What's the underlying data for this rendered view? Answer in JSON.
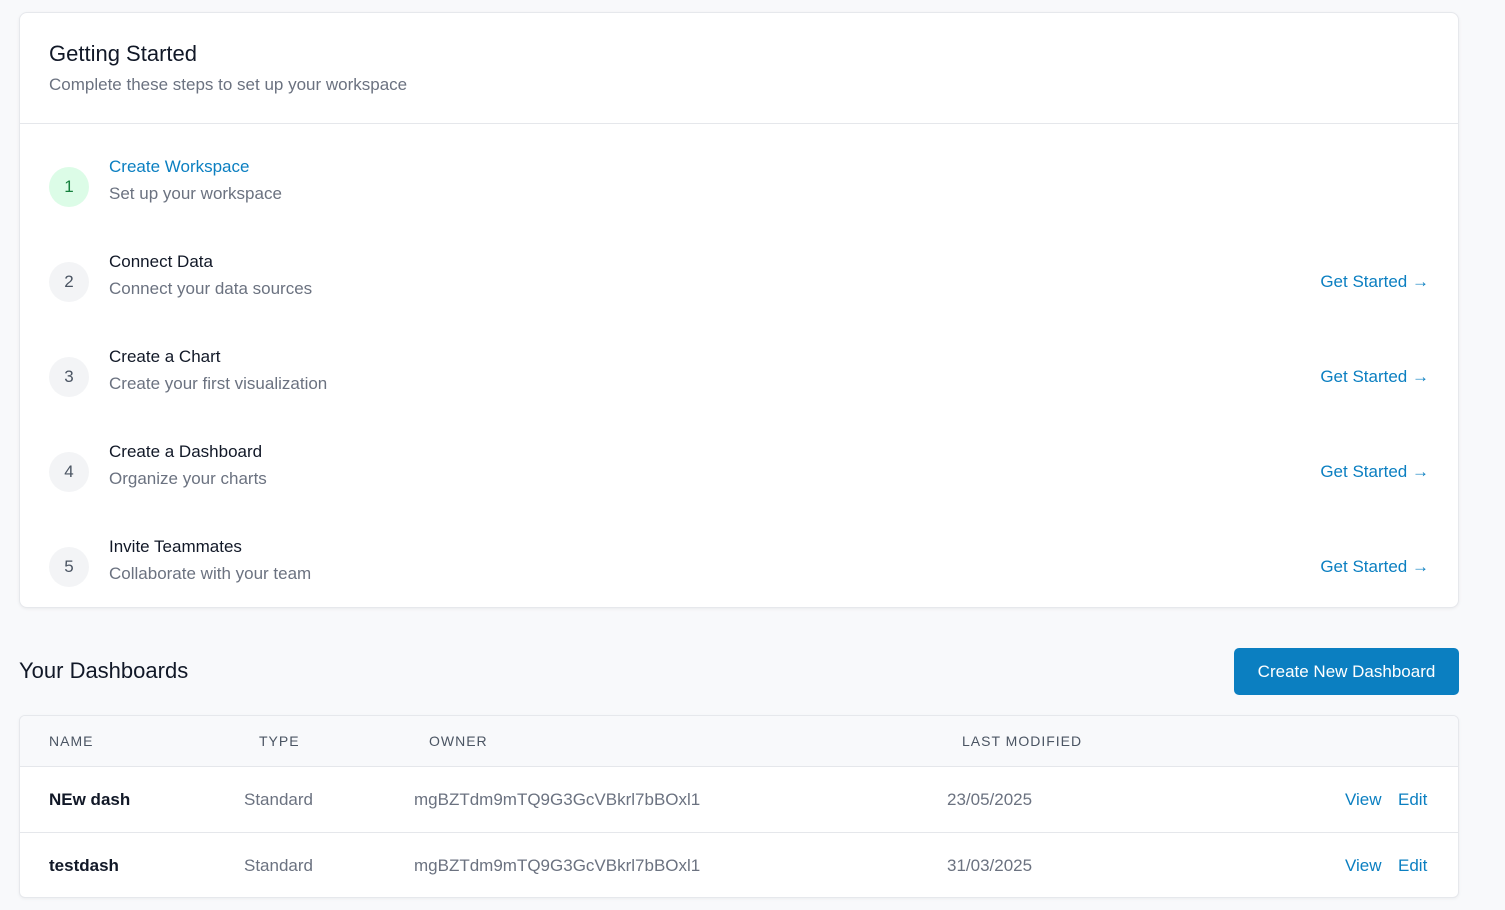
{
  "getting_started": {
    "title": "Getting Started",
    "subtitle": "Complete these steps to set up your workspace",
    "steps": [
      {
        "number": "1",
        "title": "Create Workspace",
        "description": "Set up your workspace",
        "status": "completed",
        "link": ""
      },
      {
        "number": "2",
        "title": "Connect Data",
        "description": "Connect your data sources",
        "status": "pending",
        "link": "Get Started →"
      },
      {
        "number": "3",
        "title": "Create a Chart",
        "description": "Create your first visualization",
        "status": "pending",
        "link": "Get Started →"
      },
      {
        "number": "4",
        "title": "Create a Dashboard",
        "description": "Organize your charts",
        "status": "pending",
        "link": "Get Started →"
      },
      {
        "number": "5",
        "title": "Invite Teammates",
        "description": "Collaborate with your team",
        "status": "pending",
        "link": "Get Started →"
      }
    ]
  },
  "dashboards": {
    "title": "Your Dashboards",
    "create_button": "Create New Dashboard",
    "columns": [
      "NAME",
      "TYPE",
      "OWNER",
      "LAST MODIFIED"
    ],
    "rows": [
      {
        "name": "NEw dash",
        "type": "Standard",
        "owner": "mgBZTdm9mTQ9G3GcVBkrl7bBOxl1",
        "last_modified": "23/05/2025",
        "view": "View",
        "edit": "Edit"
      },
      {
        "name": "testdash",
        "type": "Standard",
        "owner": "mgBZTdm9mTQ9G3GcVBkrl7bBOxl1",
        "last_modified": "31/03/2025",
        "view": "View",
        "edit": "Edit"
      }
    ]
  },
  "colors": {
    "accent": "#0b7fc1",
    "completed_bg": "#dcfce7",
    "completed_text": "#15803d",
    "page_bg": "#f8f9fb"
  }
}
